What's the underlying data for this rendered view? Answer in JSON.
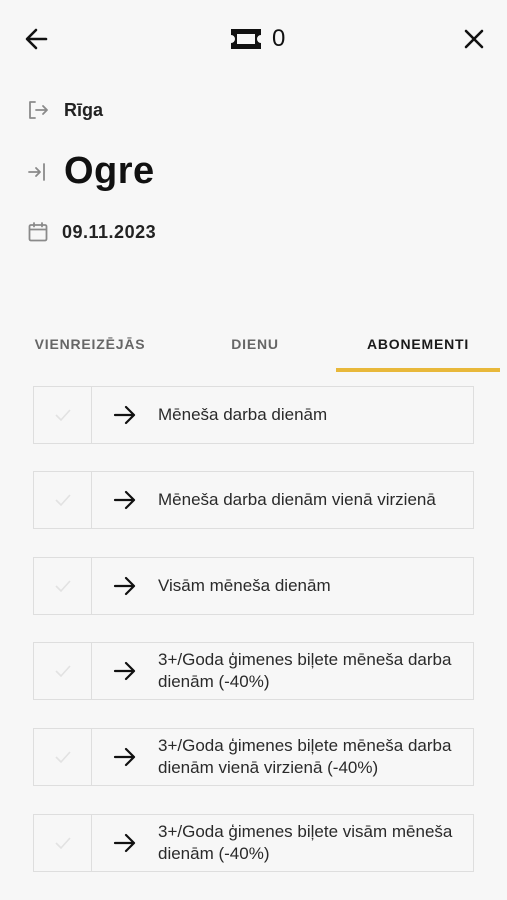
{
  "header": {
    "ticket_count": "0",
    "back_icon": "arrow-left-icon",
    "ticket_icon": "ticket-icon",
    "close_icon": "close-icon"
  },
  "route": {
    "from": "Rīga",
    "to": "Ogre",
    "date": "09.11.2023"
  },
  "tabs": [
    {
      "label": "VIENREIZĒJĀS",
      "active": false
    },
    {
      "label": "DIENU",
      "active": false
    },
    {
      "label": "ABONEMENTI",
      "active": true
    }
  ],
  "accent_color": "#e8b83a",
  "tickets": [
    {
      "label": "Mēneša darba dienām"
    },
    {
      "label": "Mēneša darba dienām vienā virzienā"
    },
    {
      "label": "Visām mēneša dienām"
    },
    {
      "label": "3+/Goda ģimenes biļete mēneša darba dienām (-40%)"
    },
    {
      "label": "3+/Goda ģimenes biļete mēneša darba dienām vienā virzienā (-40%)"
    },
    {
      "label": "3+/Goda ģimenes biļete visām mēneša dienām (-40%)"
    }
  ]
}
